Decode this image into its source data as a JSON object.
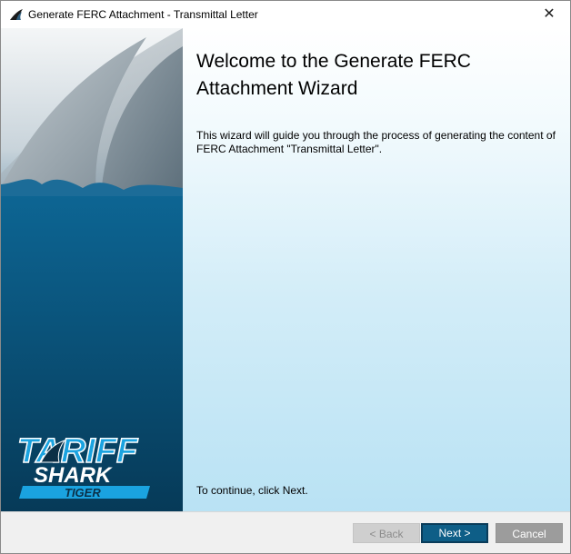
{
  "window": {
    "title": "Generate FERC Attachment - Transmittal Letter",
    "close_glyph": "✕",
    "icon": "shark-fin-icon"
  },
  "side_panel": {
    "logo_text": {
      "line1": "TARIFF",
      "line2": "SHARK",
      "line3": "TIGER"
    }
  },
  "content": {
    "heading": "Welcome to the Generate FERC Attachment Wizard",
    "intro": "This wizard will guide you through the process of generating the content of FERC Attachment  \"Transmittal Letter\".",
    "continue_text": "To continue, click Next."
  },
  "buttons": {
    "back_label": "< Back",
    "next_label": "Next >",
    "cancel_label": "Cancel"
  },
  "colors": {
    "side_panel": "#0a5f8c",
    "next_button": "#0e5e87",
    "logo_blue": "#1aa3e0"
  }
}
